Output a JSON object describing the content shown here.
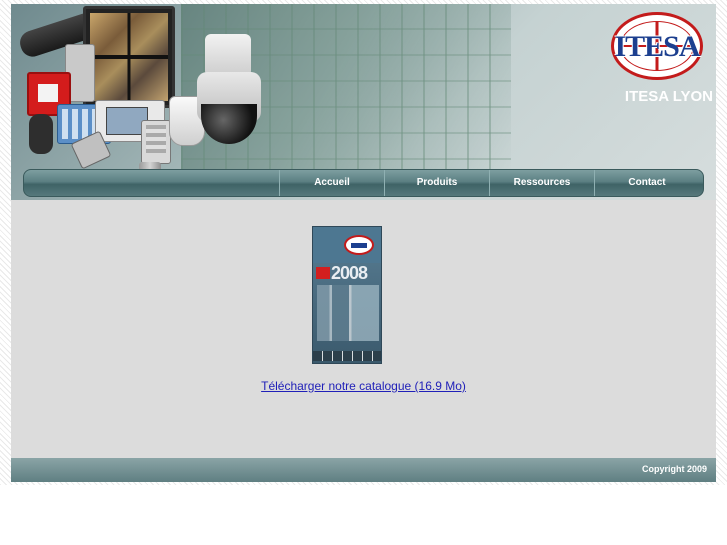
{
  "site": {
    "logo_text": "ITESA",
    "name": "ITESA LYON"
  },
  "nav": {
    "items": [
      {
        "label": "Accueil"
      },
      {
        "label": "Produits"
      },
      {
        "label": "Ressources"
      },
      {
        "label": "Contact"
      }
    ]
  },
  "main": {
    "catalog_year": "2008",
    "download_link": "Télécharger notre catalogue (16.9 Mo)"
  },
  "footer": {
    "copyright": "Copyright 2009"
  },
  "colors": {
    "nav_bar": "#4f7477",
    "page_bg": "#dcdcdc",
    "link": "#1f1fb8",
    "logo_red": "#c31b1b",
    "logo_blue": "#1c3f8f"
  }
}
